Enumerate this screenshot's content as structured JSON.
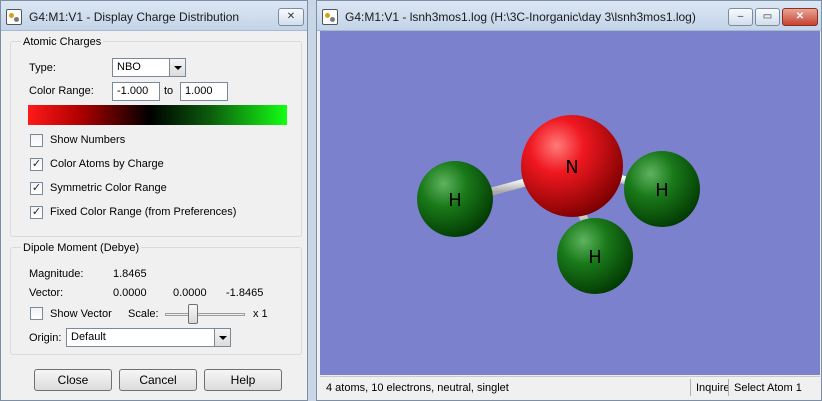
{
  "charge_dialog": {
    "title": "G4:M1:V1 - Display Charge Distribution",
    "close_button": "✕",
    "atomic_charges": {
      "group_title": "Atomic Charges",
      "type_label": "Type:",
      "type_value": "NBO",
      "color_range_label": "Color Range:",
      "color_range_min": "-1.000",
      "to_label": "to",
      "color_range_max": "1.000",
      "colors": {
        "low": "#ff1a1a",
        "mid": "#000000",
        "high": "#14ff14"
      },
      "options": [
        {
          "label": "Show Numbers",
          "checked": false,
          "mark": ""
        },
        {
          "label": "Color Atoms by Charge",
          "checked": true,
          "mark": "✓"
        },
        {
          "label": "Symmetric Color Range",
          "checked": true,
          "mark": "✓"
        },
        {
          "label": "Fixed Color Range (from Preferences)",
          "checked": true,
          "mark": "✓"
        }
      ]
    },
    "dipole_moment": {
      "group_title": "Dipole Moment (Debye)",
      "magnitude_label": "Magnitude:",
      "magnitude_value": "1.8465",
      "vector_label": "Vector:",
      "vector_x": "0.0000",
      "vector_y": "0.0000",
      "vector_z": "-1.8465",
      "show_vector_label": "Show Vector",
      "show_vector_checked": false,
      "show_vector_mark": "",
      "scale_label": "Scale:",
      "scale_value_label": "x 1",
      "scale_level": 0.35,
      "origin_label": "Origin:",
      "origin_value": "Default"
    },
    "buttons": {
      "close": "Close",
      "cancel": "Cancel",
      "help": "Help"
    }
  },
  "molecule_window": {
    "title": "G4:M1:V1 - lsnh3mos1.log (H:\\3C-Inorganic\\day 3\\lsnh3mos1.log)",
    "controls": {
      "minimize": "–",
      "maximize": "▭",
      "close": "✕"
    },
    "viewport_bg": "#7c81cd",
    "atoms": [
      {
        "symbol": "N",
        "color": "#e8121b"
      },
      {
        "symbol": "H",
        "color": "#1a7a1a"
      },
      {
        "symbol": "H",
        "color": "#1a7a1a"
      },
      {
        "symbol": "H",
        "color": "#1a7a1a"
      }
    ],
    "status": {
      "summary": "4 atoms, 10 electrons, neutral, singlet",
      "mode": "Inquire",
      "action": "Select Atom 1"
    }
  }
}
